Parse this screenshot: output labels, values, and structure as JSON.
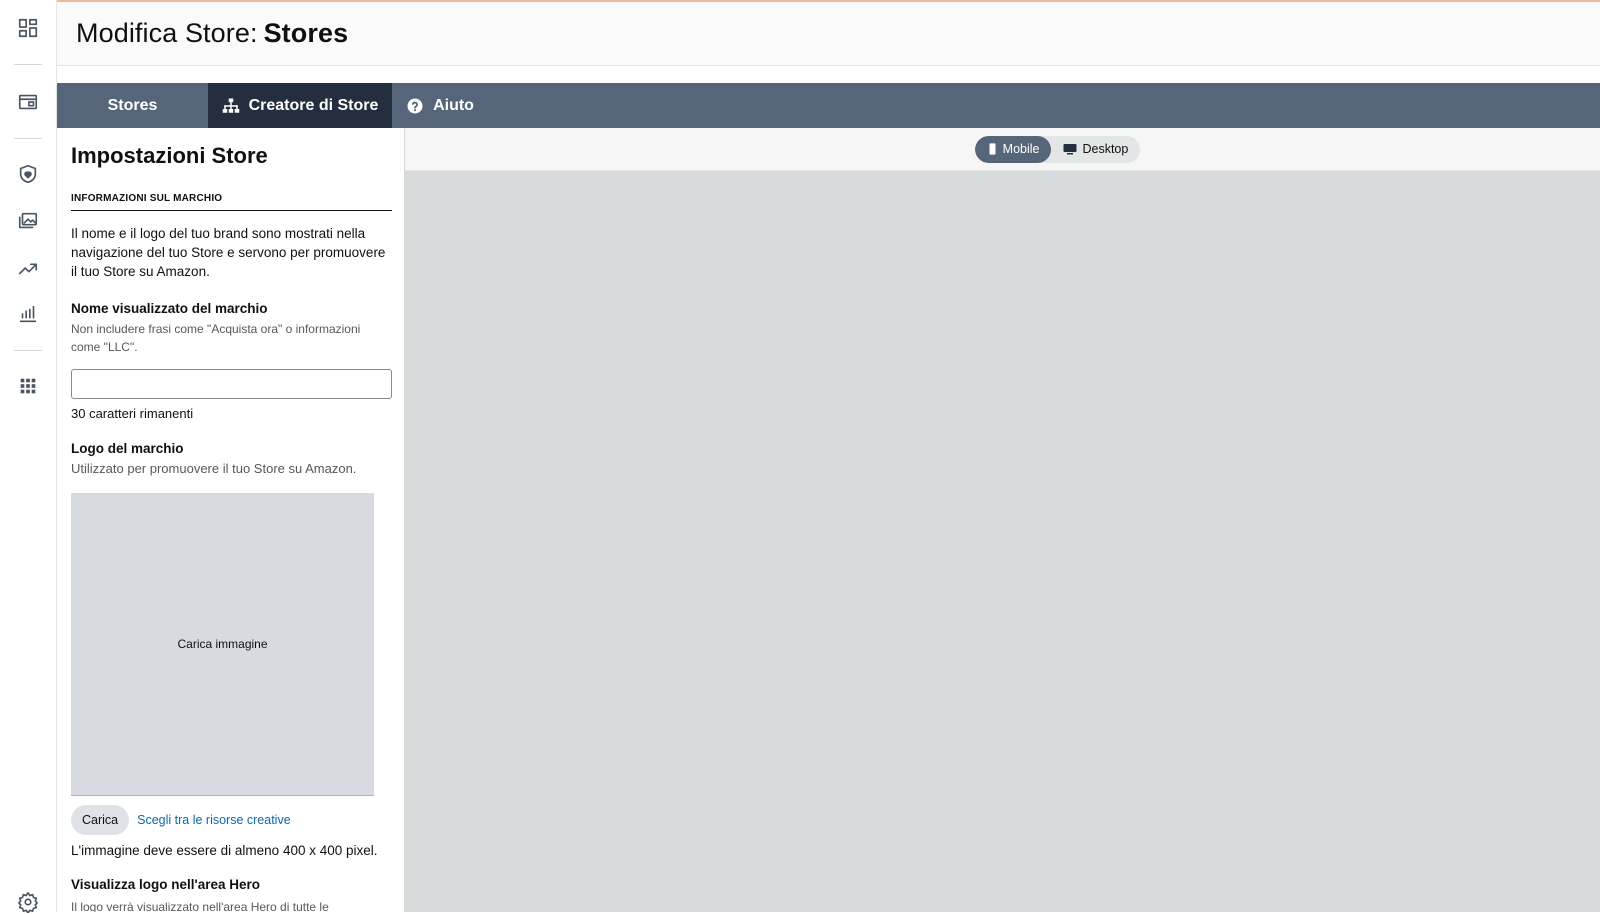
{
  "header": {
    "title_prefix": "Modifica Store:",
    "title_name": "Stores"
  },
  "nav": {
    "tabs": [
      {
        "label": "Stores",
        "active": false
      },
      {
        "label": "Creatore di Store",
        "icon": "sitemap-icon",
        "active": true
      },
      {
        "label": "Aiuto",
        "icon": "help-circle-icon",
        "active": false
      }
    ]
  },
  "rail": {
    "icons": [
      "dashboard-icon",
      "storefront-icon",
      "shield-heart-icon",
      "media-library-icon",
      "trending-up-icon",
      "bar-chart-icon",
      "apps-grid-icon",
      "settings-gear-icon"
    ]
  },
  "panel": {
    "title": "Impostazioni Store",
    "section_title": "INFORMAZIONI SUL MARCHIO",
    "intro": "Il nome e il logo del tuo brand sono mostrati nella navigazione del tuo Store e servono per promuovere il tuo Store su Amazon.",
    "brand_name": {
      "label": "Nome visualizzato del marchio",
      "help": "Non includere frasi come \"Acquista ora\" o informazioni come \"LLC\".",
      "value": "",
      "counter": "30 caratteri rimanenti"
    },
    "logo": {
      "label": "Logo del marchio",
      "help": "Utilizzato per promuovere il tuo Store su Amazon.",
      "upload_placeholder": "Carica immagine",
      "upload_button": "Carica",
      "choose_link": "Scegli tra le risorse creative",
      "note": "L'immagine deve essere di almeno 400 x 400 pixel."
    },
    "hero": {
      "label": "Visualizza logo nell'area Hero",
      "help": "Il logo verrà visualizzato nell'area Hero di tutte le"
    }
  },
  "preview": {
    "toggle": [
      {
        "label": "Mobile",
        "icon": "mobile-icon",
        "active": true
      },
      {
        "label": "Desktop",
        "icon": "desktop-icon",
        "active": false
      }
    ]
  },
  "colors": {
    "nav_bg": "#56657a",
    "nav_active_bg": "#232f3e",
    "link": "#0a6aa8",
    "canvas_bg": "#d7dbdb"
  }
}
